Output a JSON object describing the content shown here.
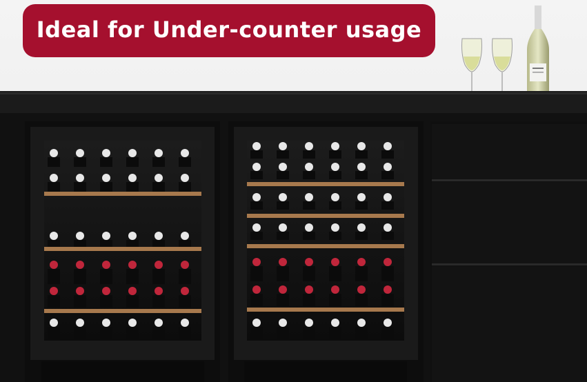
{
  "banner": {
    "text": "Ideal for Under-counter usage"
  },
  "scene": {
    "cabinet": "black under-counter cabinet",
    "wine_fridges": 2,
    "drawers": 3,
    "glasses": 2,
    "bottles_on_top": 1
  },
  "colors": {
    "banner_bg": "#a5102e",
    "banner_text": "#ffffff",
    "cabinet": "#141414",
    "shelf_wood": "#a7794d"
  }
}
